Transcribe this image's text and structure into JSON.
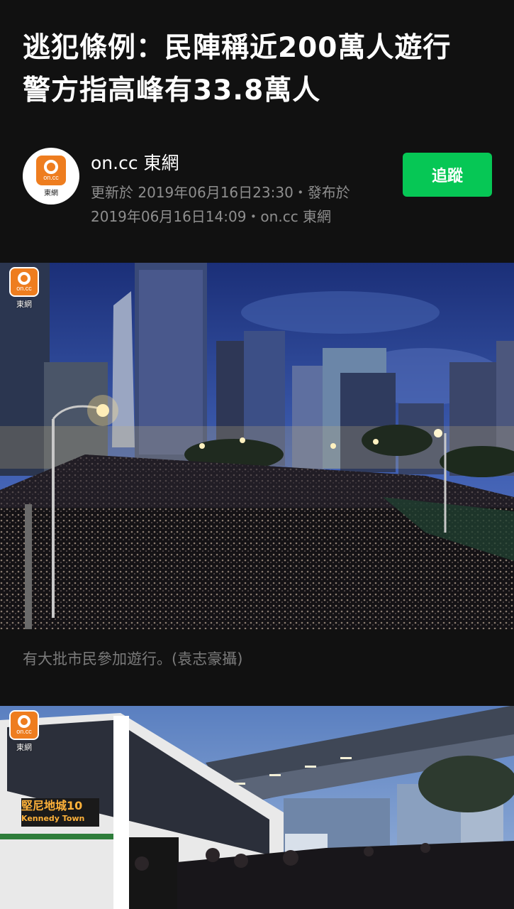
{
  "article": {
    "title": "逃犯條例：民陣稱近200萬人遊行　警方指高峰有33.8萬人"
  },
  "author": {
    "name": "on.cc 東網",
    "logo_text": "on.cc",
    "logo_cn": "東網",
    "meta": "更新於 2019年06月16日23:30・發布於 2019年06月16日14:09・on.cc 東網",
    "follow_label": "追蹤",
    "follow_color": "#06c755"
  },
  "photos": [
    {
      "watermark_text": "on.cc",
      "watermark_cn": "東網",
      "caption": "有大批市民參加遊行。(袁志豪攝)"
    },
    {
      "watermark_text": "on.cc",
      "watermark_cn": "東網",
      "bus_sign_cn": "堅尼地城10",
      "bus_sign_en": "Kennedy Town"
    }
  ]
}
